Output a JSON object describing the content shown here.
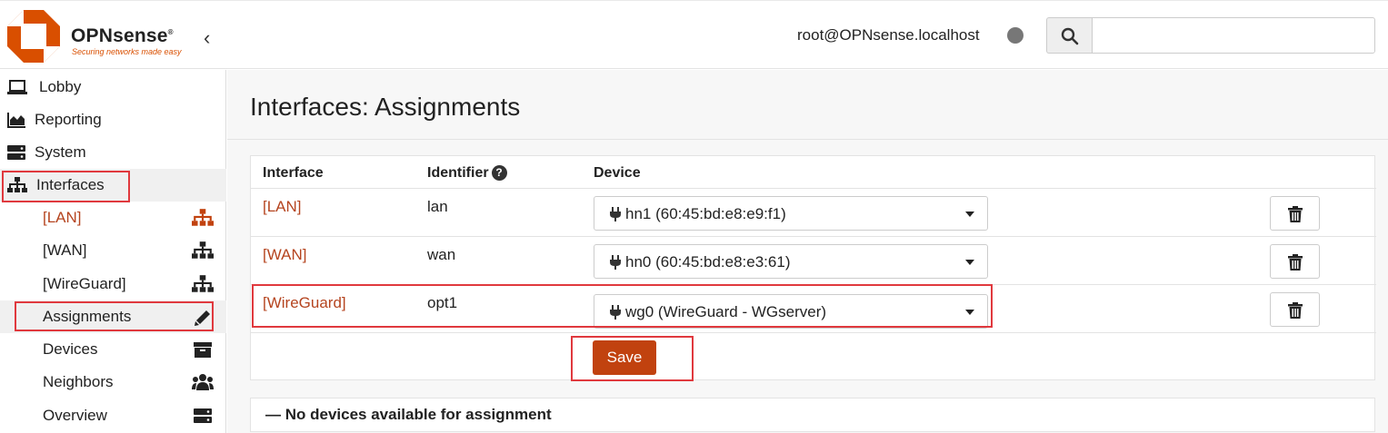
{
  "brand": {
    "name": "OPNsense",
    "registered": "®",
    "tagline": "Securing networks made easy",
    "accent": "#d94f00"
  },
  "header": {
    "user": "root@OPNsense.localhost",
    "search": {
      "value": "",
      "placeholder": ""
    }
  },
  "sidebar": {
    "items": [
      {
        "label": "Lobby",
        "icon": "laptop-icon"
      },
      {
        "label": "Reporting",
        "icon": "area-chart-icon"
      },
      {
        "label": "System",
        "icon": "server-icon"
      },
      {
        "label": "Interfaces",
        "icon": "sitemap-icon"
      }
    ],
    "sub_items": [
      {
        "label": "[LAN]",
        "icon": "sitemap-icon"
      },
      {
        "label": "[WAN]",
        "icon": "sitemap-icon"
      },
      {
        "label": "[WireGuard]",
        "icon": "sitemap-icon"
      },
      {
        "label": "Assignments",
        "icon": "pencil-icon"
      },
      {
        "label": "Devices",
        "icon": "archive-icon"
      },
      {
        "label": "Neighbors",
        "icon": "users-icon"
      },
      {
        "label": "Overview",
        "icon": "server-icon"
      }
    ]
  },
  "main": {
    "title": "Interfaces: Assignments",
    "table": {
      "headers": {
        "interface": "Interface",
        "identifier": "Identifier",
        "identifier_help": "?",
        "device": "Device"
      },
      "rows": [
        {
          "interface": "[LAN]",
          "identifier": "lan",
          "device": "hn1 (60:45:bd:e8:e9:f1)"
        },
        {
          "interface": "[WAN]",
          "identifier": "wan",
          "device": "hn0 (60:45:bd:e8:e3:61)"
        },
        {
          "interface": "[WireGuard]",
          "identifier": "opt1",
          "device": "wg0 (WireGuard - WGserver)"
        }
      ],
      "save_label": "Save"
    },
    "no_devices": {
      "toggle": "—",
      "label": "No devices available for assignment"
    }
  },
  "colors": {
    "link": "#b5441f",
    "save_button": "#c1420f",
    "highlight": "#e0393e"
  }
}
